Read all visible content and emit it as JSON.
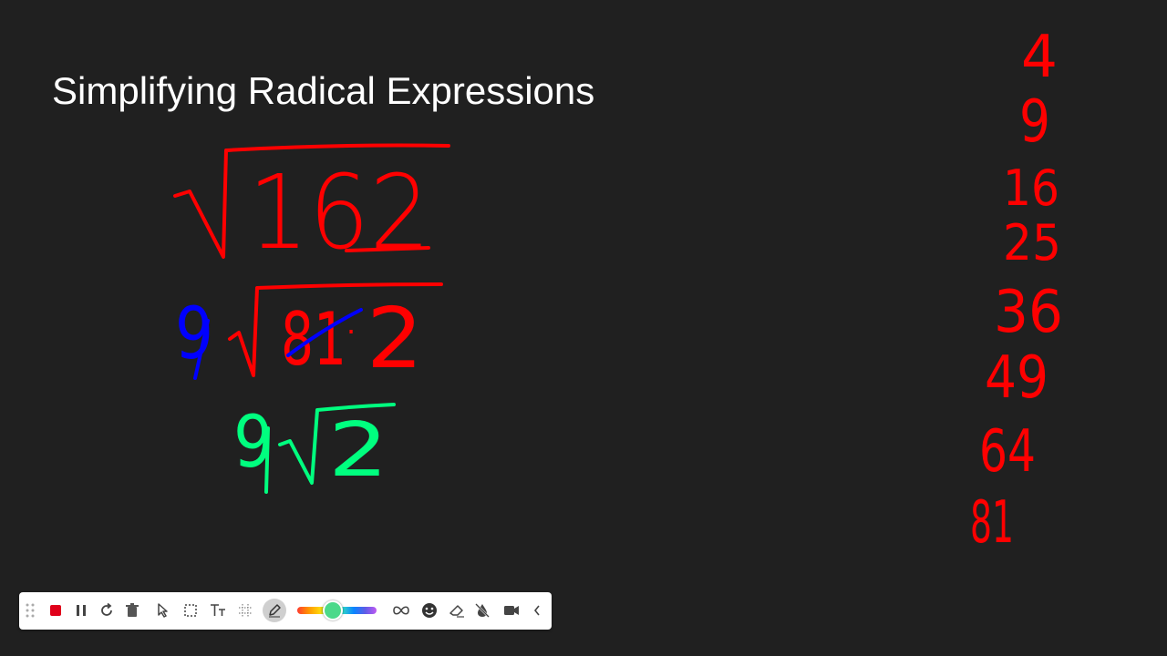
{
  "slide": {
    "title": "Simplifying Radical Expressions",
    "background_color": "#202020"
  },
  "ink": {
    "colors": {
      "red": "#ff0000",
      "blue": "#0000ff",
      "green": "#00ff7f"
    },
    "line1": {
      "radicand": "162"
    },
    "line2": {
      "coefficient": "9",
      "radicand_factor1": "81",
      "operator": "·",
      "radicand_factor2": "2"
    },
    "line3": {
      "coefficient": "9",
      "radicand": "2"
    },
    "squares_list": [
      "4",
      "9",
      "16",
      "25",
      "36",
      "49",
      "64",
      "81"
    ]
  },
  "toolbar": {
    "items": [
      {
        "name": "drag-handle-icon",
        "glyph": "⠿"
      },
      {
        "name": "stop-record-button",
        "glyph": "■"
      },
      {
        "name": "pause-button",
        "glyph": "❚❚"
      },
      {
        "name": "restart-button",
        "glyph": "↻"
      },
      {
        "name": "delete-button",
        "glyph": "🗑"
      },
      {
        "name": "pointer-tool-button",
        "glyph": "➤"
      },
      {
        "name": "select-tool-button",
        "glyph": "⬚"
      },
      {
        "name": "text-tool-button",
        "glyph": "Tт"
      },
      {
        "name": "grid-tool-button",
        "glyph": "#"
      },
      {
        "name": "pen-tool-button",
        "glyph": "✎"
      },
      {
        "name": "infinite-ink-button",
        "glyph": "∞"
      },
      {
        "name": "emoji-button",
        "glyph": "☻"
      },
      {
        "name": "eraser-button",
        "glyph": "⌫"
      },
      {
        "name": "mute-ink-button",
        "glyph": "⊘"
      },
      {
        "name": "camera-button",
        "glyph": "▶"
      },
      {
        "name": "collapse-button",
        "glyph": "‹"
      }
    ],
    "record_color": "#e0001a",
    "selected_color": "#4cd98a",
    "color_level": 0.45
  }
}
